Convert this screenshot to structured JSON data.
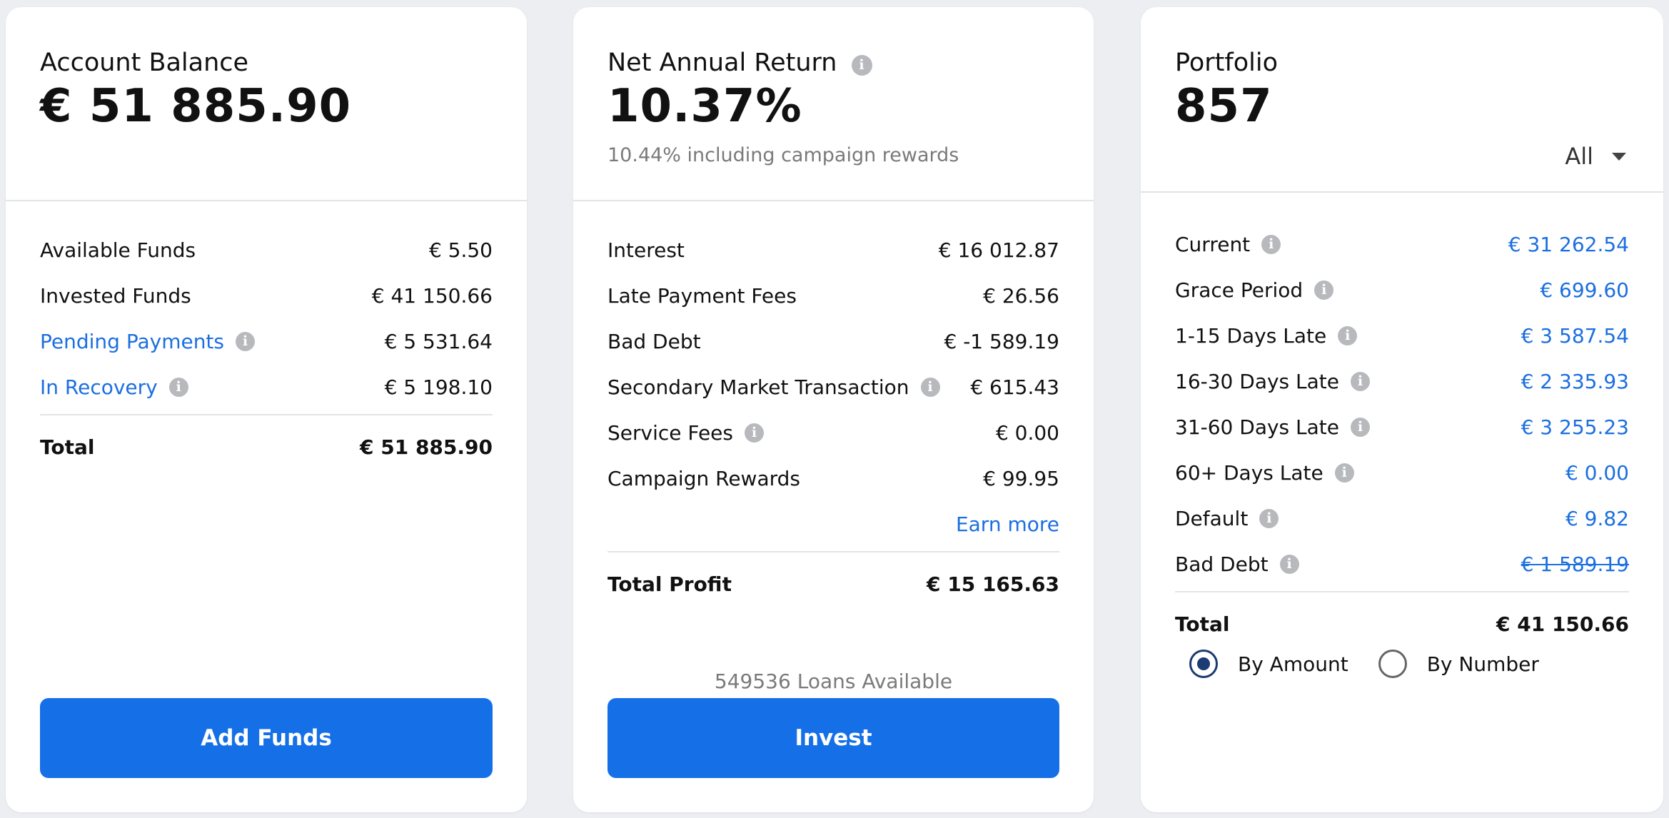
{
  "account": {
    "title": "Account Balance",
    "value": "€ 51 885.90",
    "rows": [
      {
        "label": "Available Funds",
        "value": "€ 5.50"
      },
      {
        "label": "Invested Funds",
        "value": "€ 41 150.66"
      },
      {
        "label": "Pending Payments",
        "value": "€ 5 531.64"
      },
      {
        "label": "In Recovery",
        "value": "€ 5 198.10"
      }
    ],
    "total_label": "Total",
    "total_value": "€ 51 885.90",
    "button_label": "Add Funds"
  },
  "returns": {
    "title": "Net Annual Return",
    "value": "10.37%",
    "subtitle": "10.44% including campaign rewards",
    "rows": [
      {
        "label": "Interest",
        "value": "€ 16 012.87"
      },
      {
        "label": "Late Payment Fees",
        "value": "€ 26.56"
      },
      {
        "label": "Bad Debt",
        "value": "€ -1 589.19"
      },
      {
        "label": "Secondary Market Transaction",
        "value": "€ 615.43"
      },
      {
        "label": "Service Fees",
        "value": "€ 0.00"
      },
      {
        "label": "Campaign Rewards",
        "value": "€ 99.95"
      }
    ],
    "earn_more": "Earn more",
    "total_label": "Total Profit",
    "total_value": "€ 15 165.63",
    "loans_available": "549536 Loans Available",
    "button_label": "Invest"
  },
  "portfolio": {
    "title": "Portfolio",
    "value": "857",
    "filter_selected": "All",
    "rows": [
      {
        "label": "Current",
        "value": "€ 31 262.54"
      },
      {
        "label": "Grace Period",
        "value": "€ 699.60"
      },
      {
        "label": "1-15 Days Late",
        "value": "€ 3 587.54"
      },
      {
        "label": "16-30 Days Late",
        "value": "€ 2 335.93"
      },
      {
        "label": "31-60 Days Late",
        "value": "€ 3 255.23"
      },
      {
        "label": "60+ Days Late",
        "value": "€ 0.00"
      },
      {
        "label": "Default",
        "value": "€ 9.82"
      },
      {
        "label": "Bad Debt",
        "value": "€ 1 589.19"
      }
    ],
    "total_label": "Total",
    "total_value": "€ 41 150.66",
    "radio_by_amount": "By Amount",
    "radio_by_number": "By Number",
    "radio_selected": "By Amount"
  },
  "icons": {
    "info": "info-icon",
    "info_glyph": "i",
    "dropdown": "chevron-down-icon"
  },
  "colors": {
    "link": "#1b6fe0",
    "button": "#1570e8",
    "radio_selected": "#1c3a73"
  }
}
